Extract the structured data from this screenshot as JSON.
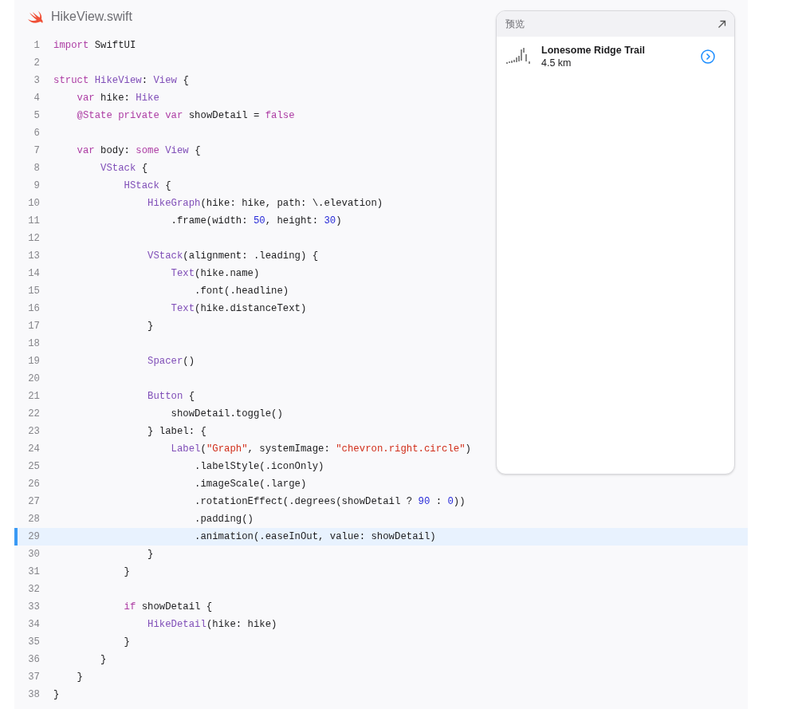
{
  "file": {
    "name": "HikeView.swift"
  },
  "code_lines": [
    {
      "number": "1",
      "highlighted": false,
      "tokens": [
        {
          "kind": "keyword",
          "text": "import"
        },
        {
          "kind": "plain",
          "text": " SwiftUI"
        }
      ]
    },
    {
      "number": "2",
      "highlighted": false
    },
    {
      "number": "3",
      "highlighted": false,
      "tokens": [
        {
          "kind": "keyword",
          "text": "struct "
        },
        {
          "kind": "type",
          "text": "HikeView"
        },
        {
          "kind": "plain",
          "text": ": "
        },
        {
          "kind": "type",
          "text": "View"
        },
        {
          "kind": "plain",
          "text": " {"
        }
      ]
    },
    {
      "number": "4",
      "highlighted": false,
      "tokens": [
        {
          "kind": "keyword",
          "text": "    var"
        },
        {
          "kind": "plain",
          "text": " hike: "
        },
        {
          "kind": "type",
          "text": "Hike"
        }
      ]
    },
    {
      "number": "5",
      "highlighted": false,
      "tokens": [
        {
          "kind": "keyword",
          "text": "    @State private var"
        },
        {
          "kind": "plain",
          "text": " showDetail = "
        },
        {
          "kind": "keyword",
          "text": "false"
        }
      ]
    },
    {
      "number": "6",
      "highlighted": false
    },
    {
      "number": "7",
      "highlighted": false,
      "tokens": [
        {
          "kind": "keyword",
          "text": "    var"
        },
        {
          "kind": "plain",
          "text": " body: "
        },
        {
          "kind": "keyword",
          "text": "some "
        },
        {
          "kind": "type",
          "text": "View"
        },
        {
          "kind": "plain",
          "text": " {"
        }
      ]
    },
    {
      "number": "8",
      "highlighted": false,
      "tokens": [
        {
          "kind": "type",
          "text": "        VStack"
        },
        {
          "kind": "plain",
          "text": " {"
        }
      ]
    },
    {
      "number": "9",
      "highlighted": false,
      "tokens": [
        {
          "kind": "type",
          "text": "            HStack"
        },
        {
          "kind": "plain",
          "text": " {"
        }
      ]
    },
    {
      "number": "10",
      "highlighted": false,
      "tokens": [
        {
          "kind": "type",
          "text": "                HikeGraph"
        },
        {
          "kind": "plain",
          "text": "(hike: hike, path: \\.elevation)"
        }
      ]
    },
    {
      "number": "11",
      "highlighted": false,
      "tokens": [
        {
          "kind": "plain",
          "text": "                    .frame(width: "
        },
        {
          "kind": "number",
          "text": "50"
        },
        {
          "kind": "plain",
          "text": ", height: "
        },
        {
          "kind": "number",
          "text": "30"
        },
        {
          "kind": "plain",
          "text": ")"
        }
      ]
    },
    {
      "number": "12",
      "highlighted": false
    },
    {
      "number": "13",
      "highlighted": false,
      "tokens": [
        {
          "kind": "type",
          "text": "                VStack"
        },
        {
          "kind": "plain",
          "text": "(alignment: .leading) {"
        }
      ]
    },
    {
      "number": "14",
      "highlighted": false,
      "tokens": [
        {
          "kind": "type",
          "text": "                    Text"
        },
        {
          "kind": "plain",
          "text": "(hike.name)"
        }
      ]
    },
    {
      "number": "15",
      "highlighted": false,
      "tokens": [
        {
          "kind": "plain",
          "text": "                        .font(.headline)"
        }
      ]
    },
    {
      "number": "16",
      "highlighted": false,
      "tokens": [
        {
          "kind": "type",
          "text": "                    Text"
        },
        {
          "kind": "plain",
          "text": "(hike.distanceText)"
        }
      ]
    },
    {
      "number": "17",
      "highlighted": false,
      "tokens": [
        {
          "kind": "plain",
          "text": "                }"
        }
      ]
    },
    {
      "number": "18",
      "highlighted": false
    },
    {
      "number": "19",
      "highlighted": false,
      "tokens": [
        {
          "kind": "type",
          "text": "                Spacer"
        },
        {
          "kind": "plain",
          "text": "()"
        }
      ]
    },
    {
      "number": "20",
      "highlighted": false
    },
    {
      "number": "21",
      "highlighted": false,
      "tokens": [
        {
          "kind": "type",
          "text": "                Button"
        },
        {
          "kind": "plain",
          "text": " {"
        }
      ]
    },
    {
      "number": "22",
      "highlighted": false,
      "tokens": [
        {
          "kind": "plain",
          "text": "                    showDetail.toggle()"
        }
      ]
    },
    {
      "number": "23",
      "highlighted": false,
      "tokens": [
        {
          "kind": "plain",
          "text": "                } label: {"
        }
      ]
    },
    {
      "number": "24",
      "highlighted": false,
      "tokens": [
        {
          "kind": "type",
          "text": "                    Label"
        },
        {
          "kind": "plain",
          "text": "("
        },
        {
          "kind": "string",
          "text": "\"Graph\""
        },
        {
          "kind": "plain",
          "text": ", systemImage: "
        },
        {
          "kind": "string",
          "text": "\"chevron.right.circle\""
        },
        {
          "kind": "plain",
          "text": ")"
        }
      ]
    },
    {
      "number": "25",
      "highlighted": false,
      "tokens": [
        {
          "kind": "plain",
          "text": "                        .labelStyle(.iconOnly)"
        }
      ]
    },
    {
      "number": "26",
      "highlighted": false,
      "tokens": [
        {
          "kind": "plain",
          "text": "                        .imageScale(.large)"
        }
      ]
    },
    {
      "number": "27",
      "highlighted": false,
      "tokens": [
        {
          "kind": "plain",
          "text": "                        .rotationEffect(.degrees(showDetail ? "
        },
        {
          "kind": "number",
          "text": "90"
        },
        {
          "kind": "plain",
          "text": " : "
        },
        {
          "kind": "number",
          "text": "0"
        },
        {
          "kind": "plain",
          "text": "))"
        }
      ]
    },
    {
      "number": "28",
      "highlighted": false,
      "tokens": [
        {
          "kind": "plain",
          "text": "                        .padding()"
        }
      ]
    },
    {
      "number": "29",
      "highlighted": true,
      "tokens": [
        {
          "kind": "plain",
          "text": "                        .animation(.easeInOut, value: showDetail)"
        }
      ]
    },
    {
      "number": "30",
      "highlighted": false,
      "tokens": [
        {
          "kind": "plain",
          "text": "                }"
        }
      ]
    },
    {
      "number": "31",
      "highlighted": false,
      "tokens": [
        {
          "kind": "plain",
          "text": "            }"
        }
      ]
    },
    {
      "number": "32",
      "highlighted": false
    },
    {
      "number": "33",
      "highlighted": false,
      "tokens": [
        {
          "kind": "keyword",
          "text": "            if"
        },
        {
          "kind": "plain",
          "text": " showDetail {"
        }
      ]
    },
    {
      "number": "34",
      "highlighted": false,
      "tokens": [
        {
          "kind": "type",
          "text": "                HikeDetail"
        },
        {
          "kind": "plain",
          "text": "(hike: hike)"
        }
      ]
    },
    {
      "number": "35",
      "highlighted": false,
      "tokens": [
        {
          "kind": "plain",
          "text": "            }"
        }
      ]
    },
    {
      "number": "36",
      "highlighted": false,
      "tokens": [
        {
          "kind": "plain",
          "text": "        }"
        }
      ]
    },
    {
      "number": "37",
      "highlighted": false,
      "tokens": [
        {
          "kind": "plain",
          "text": "    }"
        }
      ]
    },
    {
      "number": "38",
      "highlighted": false,
      "tokens": [
        {
          "kind": "plain",
          "text": "}"
        }
      ]
    }
  ],
  "preview": {
    "title": "预览",
    "hike": {
      "name": "Lonesome Ridge Trail",
      "distance": "4.5 km"
    }
  }
}
